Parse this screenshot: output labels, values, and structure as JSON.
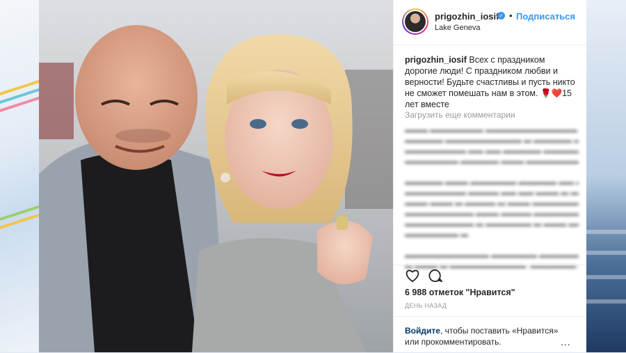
{
  "post": {
    "username": "prigozhin_iosif",
    "dot": "•",
    "follow_label": "Подписаться",
    "location": "Lake Geneva",
    "caption_text": "Всех с праздником дорогие люди! С праздником любви и верности! Будьте счастливы и пусть никто не сможет помешать нам в этом. 🌹❤️15 лет вместе",
    "load_more": "Загрузить еще комментарии",
    "likes": "6 988 отметок \"Нравится\"",
    "time": "ДЕНЬ НАЗАД",
    "login_link": "Войдите",
    "login_rest": ", чтобы поставить «Нравится» или прокомментировать.",
    "more": "..."
  },
  "icons": {
    "heart": "heart-outline-icon",
    "comment": "comment-bubble-icon",
    "verified": "verified-badge-icon"
  },
  "colors": {
    "accent": "#3897f0",
    "text": "#262626",
    "muted": "#999999",
    "link": "#003569"
  }
}
